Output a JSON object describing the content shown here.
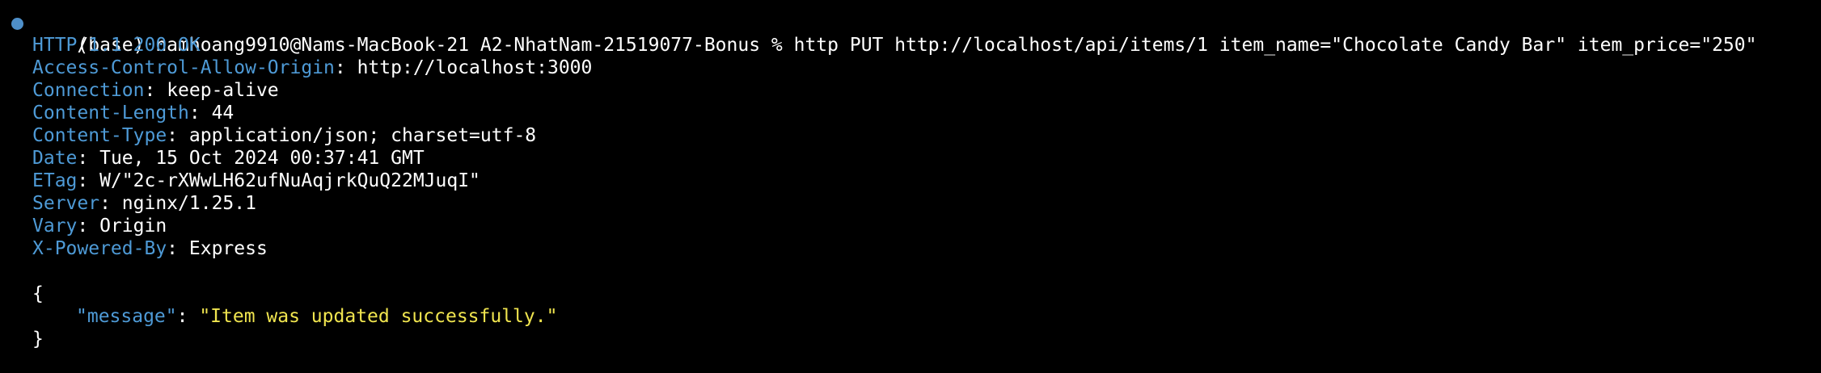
{
  "colors": {
    "background": "#000000",
    "header_key": "#4e9ad6",
    "json_string": "#f0e54f",
    "text": "#ffffff",
    "prompt_dot": "#4e8fc9"
  },
  "prompt": {
    "text": "(base) namhoang9910@Nams-MacBook-21 A2-NhatNam-21519077-Bonus % http PUT http://localhost/api/items/1 item_name=\"Chocolate Candy Bar\" item_price=\"250\""
  },
  "status": {
    "protocol": "HTTP",
    "slash": "/",
    "rest": "1.1 200 OK"
  },
  "headers": [
    {
      "name": "Access-Control-Allow-Origin",
      "value": "http://localhost:3000"
    },
    {
      "name": "Connection",
      "value": "keep-alive"
    },
    {
      "name": "Content-Length",
      "value": "44"
    },
    {
      "name": "Content-Type",
      "value": "application/json; charset=utf-8"
    },
    {
      "name": "Date",
      "value": "Tue, 15 Oct 2024 00:37:41 GMT"
    },
    {
      "name": "ETag",
      "value": "W/\"2c-rXWwLH62ufNuAqjrkQuQ22MJuqI\""
    },
    {
      "name": "Server",
      "value": "nginx/1.25.1"
    },
    {
      "name": "Vary",
      "value": "Origin"
    },
    {
      "name": "X-Powered-By",
      "value": "Express"
    }
  ],
  "body": {
    "open_brace": "{",
    "key": "\"message\"",
    "colon": ": ",
    "value": "\"Item was updated successfully.\"",
    "close_brace": "}"
  }
}
